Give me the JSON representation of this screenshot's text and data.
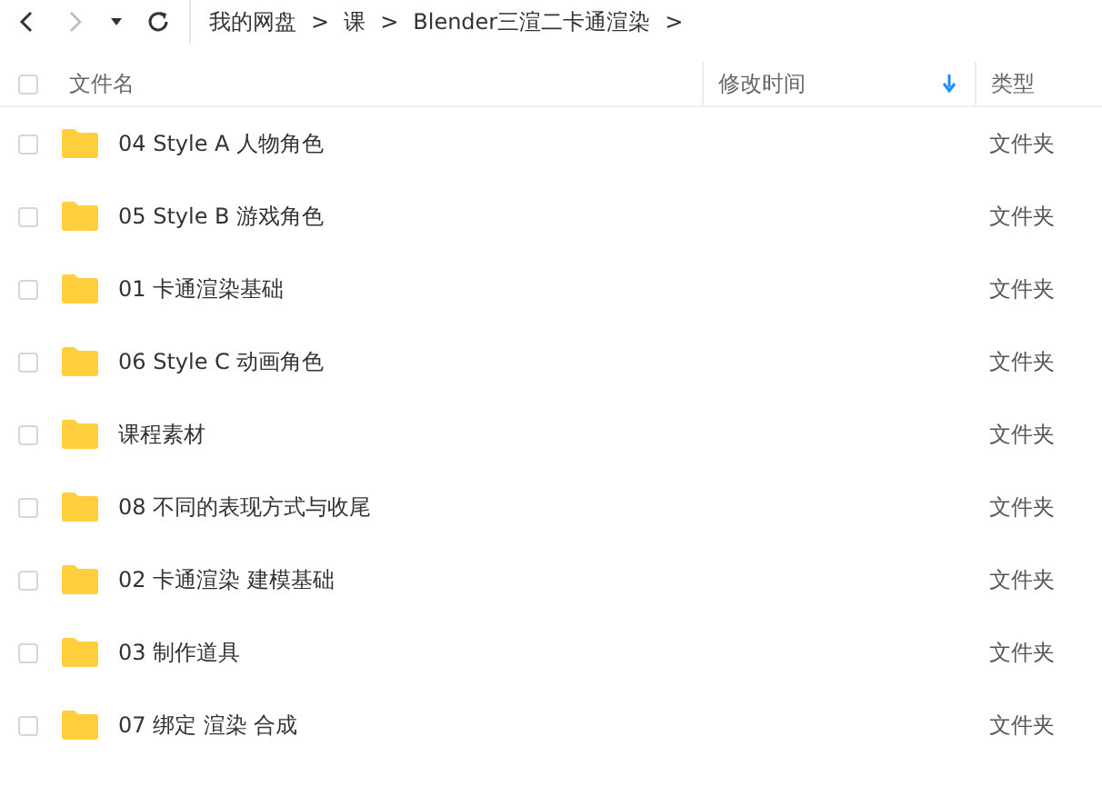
{
  "toolbar": {
    "breadcrumb": [
      "我的网盘",
      "课",
      "Blender三渲二卡通渲染"
    ],
    "separator": ">"
  },
  "table": {
    "all_checked": false,
    "columns": [
      {
        "label": "文件名",
        "sorted": false
      },
      {
        "label": "修改时间",
        "sorted": true
      },
      {
        "label": "类型",
        "sorted": false
      }
    ],
    "rows": [
      {
        "name": "04 Style A 人物角色",
        "type": "文件夹",
        "checked": false
      },
      {
        "name": "05 Style B 游戏角色",
        "type": "文件夹",
        "checked": false
      },
      {
        "name": "01 卡通渲染基础",
        "type": "文件夹",
        "checked": false
      },
      {
        "name": "06 Style C 动画角色",
        "type": "文件夹",
        "checked": false
      },
      {
        "name": "课程素材",
        "type": "文件夹",
        "checked": false
      },
      {
        "name": "08 不同的表现方式与收尾",
        "type": "文件夹",
        "checked": false
      },
      {
        "name": "02 卡通渲染 建模基础",
        "type": "文件夹",
        "checked": false
      },
      {
        "name": "03 制作道具",
        "type": "文件夹",
        "checked": false
      },
      {
        "name": "07 绑定 渲染 合成",
        "type": "文件夹",
        "checked": false
      }
    ]
  }
}
